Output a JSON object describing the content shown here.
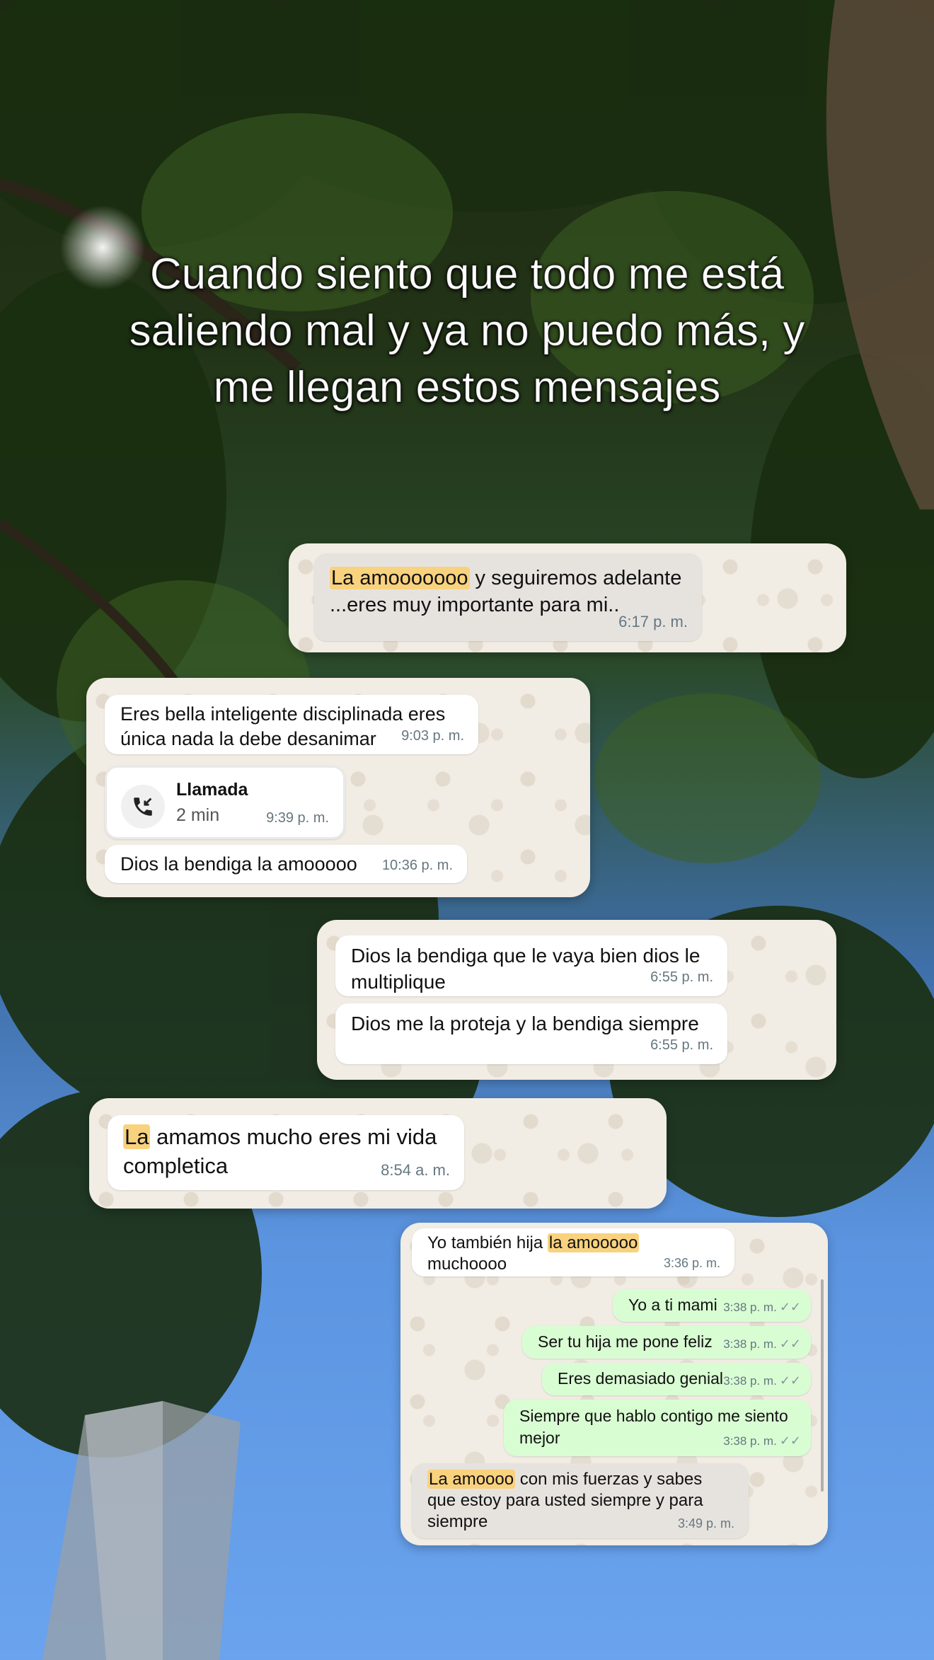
{
  "caption": "Cuando siento que todo me está saliendo mal y ya no puedo más, y me llegan estos mensajes",
  "colors": {
    "chat_background": "#f1ece4",
    "incoming_bubble": "#ffffff",
    "outgoing_bubble": "#d9fdd3",
    "highlight": "#f9d27e",
    "timestamp": "#667781"
  },
  "shot1": {
    "msg1": {
      "hl": "La amooooooo",
      "text": " y seguiremos adelante ...eres muy importante para mi..",
      "time": "6:17 p. m."
    }
  },
  "shot2": {
    "msg1": {
      "text": "Eres bella inteligente disciplinada eres única nada la debe desanimar",
      "time": "9:03 p. m."
    },
    "call": {
      "icon": "incoming-call-icon",
      "title": "Llamada",
      "duration": "2 min",
      "time": "9:39 p. m."
    },
    "msg2": {
      "text": "Dios la bendiga la amooooo",
      "time": "10:36 p. m."
    }
  },
  "shot3": {
    "msg1": {
      "text": "Dios la bendiga que le vaya bien dios le multiplique",
      "time": "6:55 p. m."
    },
    "msg2": {
      "text": "Dios me la proteja y la bendiga siempre",
      "time": "6:55 p. m."
    }
  },
  "shot4": {
    "msg1": {
      "hl": "La",
      "text": " amamos mucho eres mi vida completica",
      "time": "8:54 a. m."
    }
  },
  "shot5": {
    "msg1": {
      "pre": "Yo también hija ",
      "hl": "la amooooo",
      "post": " muchoooo",
      "time": "3:36 p. m."
    },
    "out1": {
      "text": "Yo a ti mami",
      "time": "3:38 p. m."
    },
    "out2": {
      "text": "Ser tu hija me pone feliz",
      "time": "3:38 p. m."
    },
    "out3": {
      "text": "Eres demasiado genial",
      "time": "3:38 p. m."
    },
    "out4": {
      "text": "Siempre que hablo contigo me siento mejor",
      "time": "3:38 p. m."
    },
    "msg2": {
      "hl": "La amoooo",
      "text": " con mis fuerzas y sabes que estoy para usted siempre y para siempre",
      "time": "3:49 p. m."
    }
  }
}
